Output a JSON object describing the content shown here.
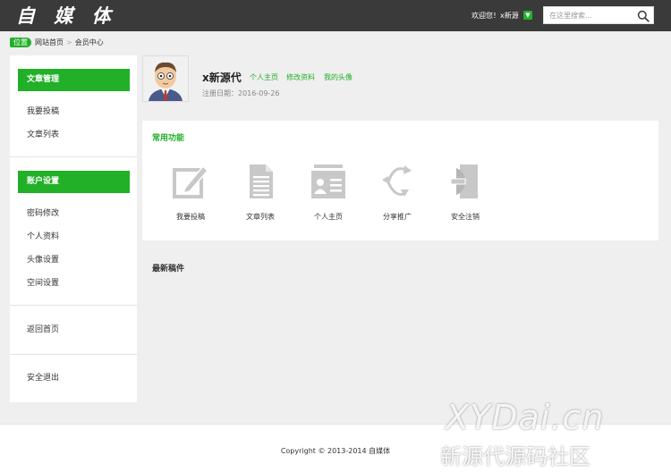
{
  "header": {
    "logo": "自 媒 体",
    "welcome_text": "欢迎您！",
    "username": "x新源",
    "search_placeholder": "在这里搜索..."
  },
  "breadcrumb": {
    "tag": "位置",
    "items": [
      "网站首页",
      "会员中心"
    ]
  },
  "sidebar": {
    "article_group": {
      "title": "文章管理",
      "items": [
        "我要投稿",
        "文章列表"
      ]
    },
    "account_group": {
      "title": "账户设置",
      "items": [
        "密码修改",
        "个人资料",
        "头像设置",
        "空间设置"
      ]
    },
    "home": "返回首页",
    "logout": "安全退出"
  },
  "profile": {
    "name": "x新源代",
    "links": [
      "个人主页",
      "修改资料",
      "我的头像"
    ],
    "reg_label": "注册日期：",
    "reg_date": "2016-09-26"
  },
  "common": {
    "title": "常用功能",
    "items": [
      {
        "label": "我要投稿",
        "icon": "edit-icon"
      },
      {
        "label": "文章列表",
        "icon": "document-icon"
      },
      {
        "label": "个人主页",
        "icon": "id-card-icon"
      },
      {
        "label": "分享推广",
        "icon": "share-icon"
      },
      {
        "label": "安全注销",
        "icon": "exit-icon"
      }
    ]
  },
  "latest": {
    "title": "最新稿件"
  },
  "footer": {
    "copyright": "Copyright © 2013-2014 自媒体"
  },
  "watermark": {
    "line1": "XYDai.cn",
    "line2": "新源代源码社区"
  },
  "colors": {
    "accent": "#22b028",
    "topbar": "#3a3a3a",
    "background": "#efefef",
    "icon_gray": "#c8c8c8"
  }
}
